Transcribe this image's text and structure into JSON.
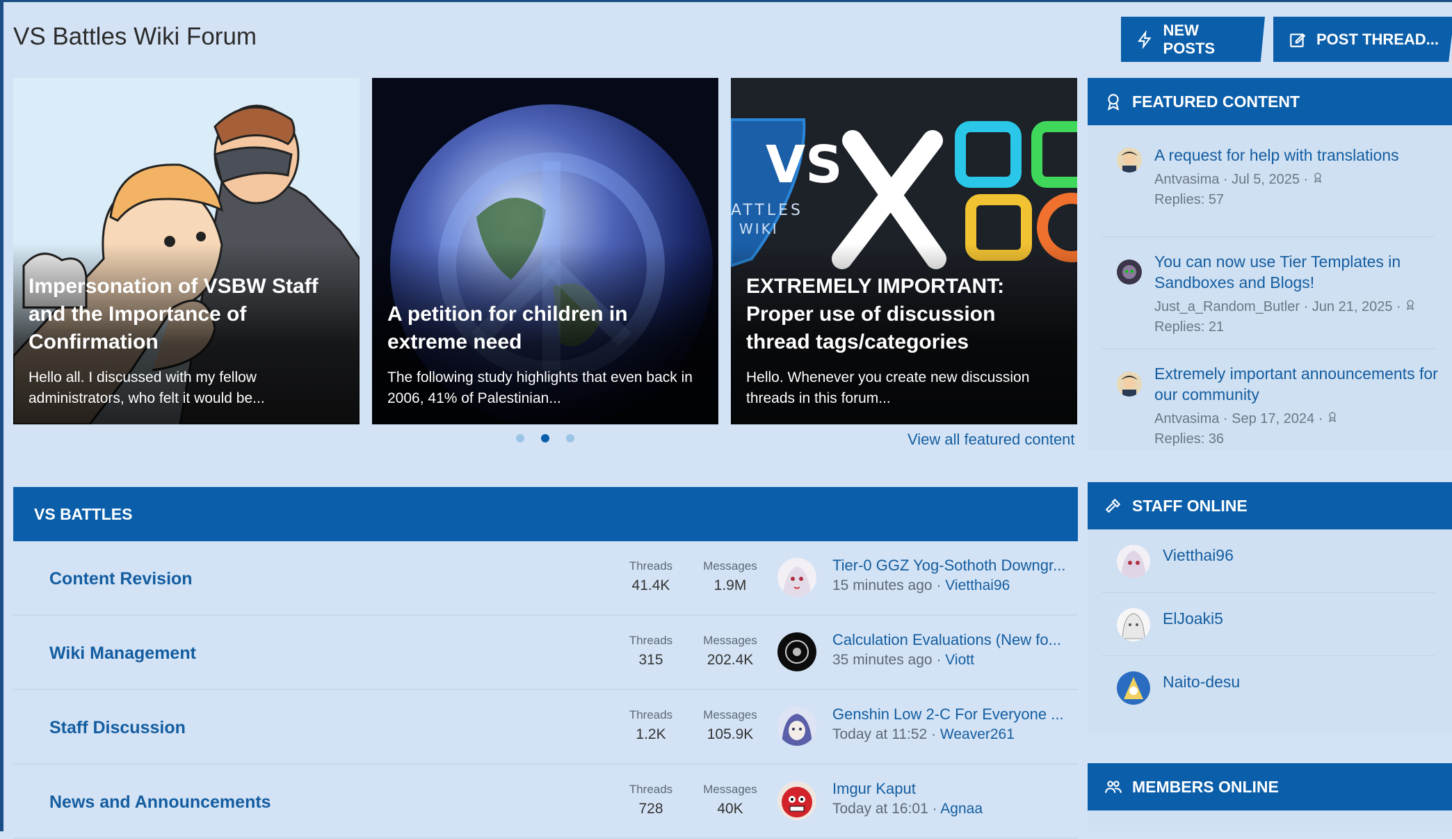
{
  "page": {
    "title": "VS Battles Wiki Forum"
  },
  "buttons": {
    "new_posts": "NEW POSTS",
    "post_thread": "POST THREAD..."
  },
  "carousel": {
    "slides": [
      {
        "title": "Impersonation of VSBW Staff and the Importance of Confirmation",
        "snippet": "Hello all. I discussed with my fellow administrators, who felt it would be..."
      },
      {
        "title": "A petition for children in extreme need",
        "snippet": "The following study highlights that even back in 2006, 41% of Palestinian..."
      },
      {
        "title": "EXTREMELY IMPORTANT: Proper use of discussion thread tags/categories",
        "snippet": "Hello. Whenever you create new discussion threads in this forum...",
        "image_text": {
          "logo_letters": "VS",
          "logo_sub": "ATTLES\nWIKI"
        }
      }
    ],
    "active_dot": 2,
    "view_all": "View all featured content"
  },
  "forum": {
    "section_title": "VS BATTLES",
    "threads_label": "Threads",
    "messages_label": "Messages",
    "nodes": [
      {
        "name": "Content Revision",
        "threads": "41.4K",
        "messages": "1.9M",
        "latest_title": "Tier-0 GGZ Yog-Sothoth Downgr...",
        "latest_time": "15 minutes ago",
        "latest_user": "Vietthai96"
      },
      {
        "name": "Wiki Management",
        "threads": "315",
        "messages": "202.4K",
        "latest_title": "Calculation Evaluations (New fo...",
        "latest_time": "35 minutes ago",
        "latest_user": "Viott"
      },
      {
        "name": "Staff Discussion",
        "threads": "1.2K",
        "messages": "105.9K",
        "latest_title": "Genshin Low 2-C For Everyone ...",
        "latest_time": "Today at 11:52",
        "latest_user": "Weaver261"
      },
      {
        "name": "News and Announcements",
        "threads": "728",
        "messages": "40K",
        "latest_title": "Imgur Kaput",
        "latest_time": "Today at 16:01",
        "latest_user": "Agnaa"
      }
    ]
  },
  "sidebar": {
    "featured_title": "FEATURED CONTENT",
    "featured": [
      {
        "title": "A request for help with translations",
        "meta": "Antvasima · Jul 5, 2025 ·",
        "replies": "Replies: 57"
      },
      {
        "title": "You can now use Tier Templates in Sandboxes and Blogs!",
        "meta": "Just_a_Random_Butler · Jun 21, 2025 ·",
        "replies": "Replies: 21"
      },
      {
        "title": "Extremely important announcements for our community",
        "meta": "Antvasima · Sep 17, 2024 ·",
        "replies": "Replies: 36"
      }
    ],
    "staff_title": "STAFF ONLINE",
    "staff": [
      "Vietthai96",
      "ElJoaki5",
      "Naito-desu"
    ],
    "members_title": "MEMBERS ONLINE"
  },
  "colors": {
    "accent": "#0b5faa",
    "page_bg": "#d3e3f5",
    "link": "#145da0"
  }
}
